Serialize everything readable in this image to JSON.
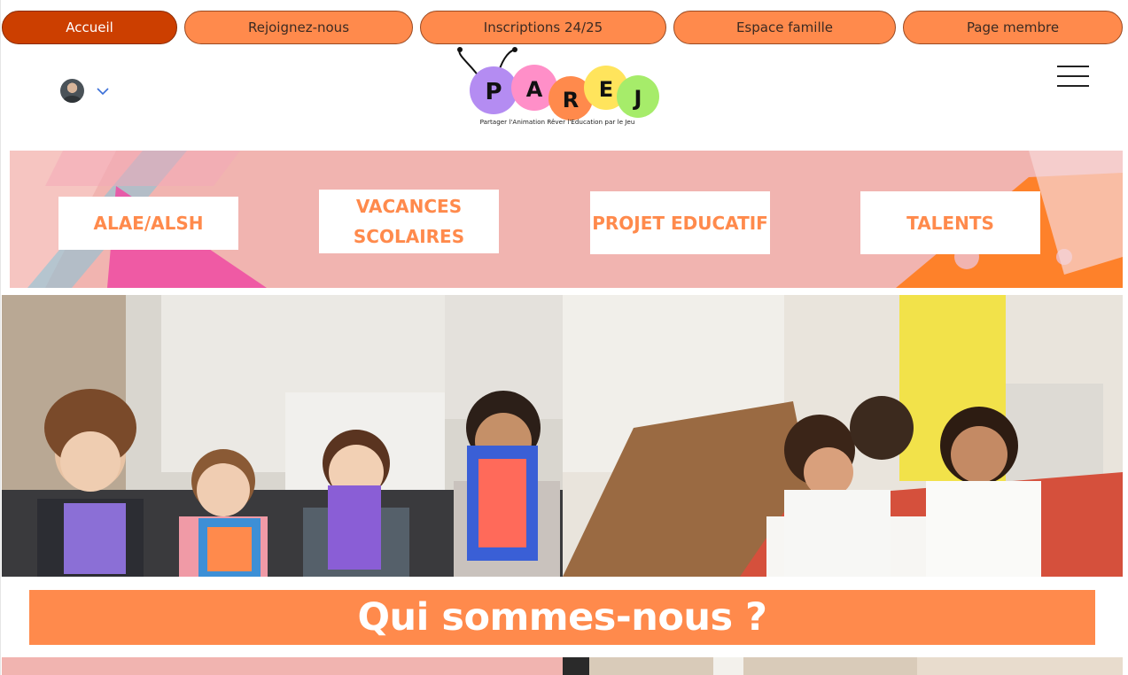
{
  "nav": {
    "items": [
      {
        "label": "Accueil",
        "active": true
      },
      {
        "label": "Rejoignez-nous",
        "active": false
      },
      {
        "label": "Inscriptions 24/25",
        "active": false
      },
      {
        "label": "Espace famille",
        "active": false
      },
      {
        "label": "Page membre",
        "active": false
      }
    ]
  },
  "header": {
    "logo": {
      "letters": [
        "P",
        "A",
        "R",
        "E",
        "J"
      ],
      "tagline": "Partager l'Animation Rêver l'Education par le Jeu"
    },
    "account_icon": "avatar",
    "menu_icon": "hamburger-icon"
  },
  "categories": [
    {
      "label": "ALAE/ALSH"
    },
    {
      "label": "VACANCES\nSCOLAIRES"
    },
    {
      "label": "PROJET EDUCATIF"
    },
    {
      "label": "TALENTS"
    }
  ],
  "section": {
    "title": "Qui sommes-nous ?"
  },
  "colors": {
    "accent": "#ff8a4c",
    "active_nav": "#cc3f00",
    "banner_bg": "#f1b4b0"
  }
}
